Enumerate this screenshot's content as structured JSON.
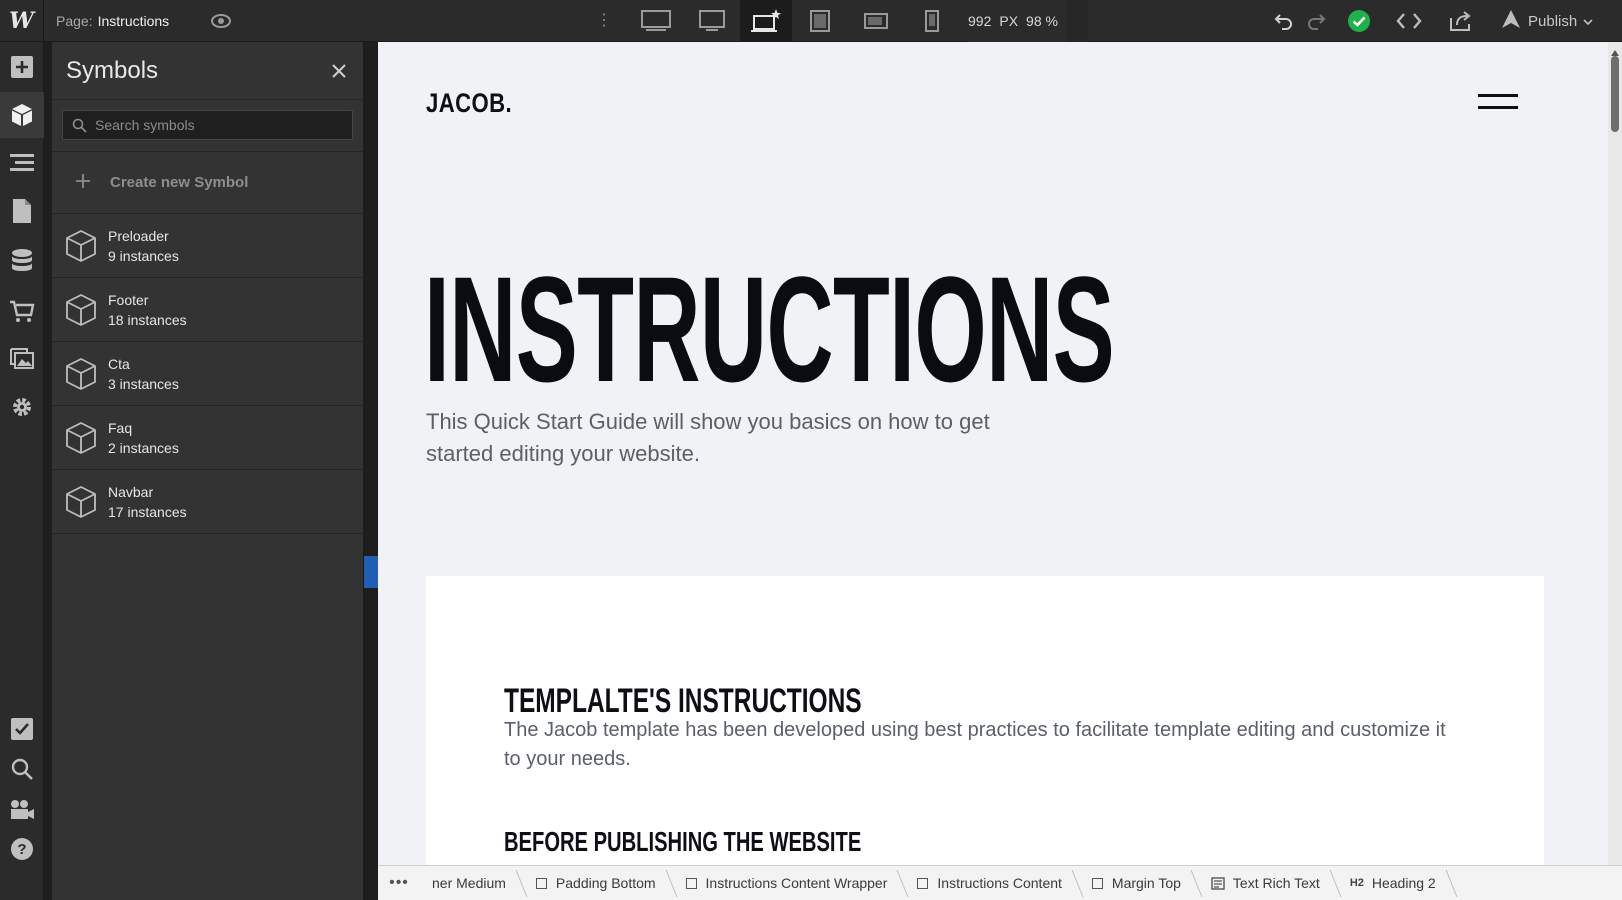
{
  "topbar": {
    "logo": "W",
    "page_prefix": "Page:",
    "page_name": "Instructions",
    "width_value": "992",
    "width_unit": "PX",
    "zoom": "98 %",
    "publish_label": "Publish"
  },
  "panel": {
    "title": "Symbols",
    "search_placeholder": "Search symbols",
    "create_label": "Create new Symbol",
    "symbols": [
      {
        "name": "Preloader",
        "count": "9 instances"
      },
      {
        "name": "Footer",
        "count": "18 instances"
      },
      {
        "name": "Cta",
        "count": "3 instances"
      },
      {
        "name": "Faq",
        "count": "2 instances"
      },
      {
        "name": "Navbar",
        "count": "17 instances"
      }
    ]
  },
  "canvas": {
    "brand": "JACOB.",
    "hero": "INSTRUCTIONS",
    "subtitle": "This Quick Start Guide will show you basics on how to get started editing your website.",
    "card_heading": "TEMPLALTE'S INSTRUCTIONS",
    "card_text": "The Jacob template has been developed using best practices to facilitate template editing and customize it to your needs.",
    "card_heading2": "BEFORE PUBLISHING THE WEBSITE"
  },
  "breadcrumb": {
    "items": [
      "ner Medium",
      "Padding Bottom",
      "Instructions Content Wrapper",
      "Instructions Content",
      "Margin Top",
      "Text Rich Text",
      "Heading 2"
    ],
    "heading_tag": "H2"
  },
  "colors": {
    "topbar_bg": "#2b2b2b",
    "panel_bg": "#333333",
    "canvas_bg": "#f0f2f5",
    "status_green": "#1fb14b",
    "selection_blue": "#1f5fb4"
  }
}
